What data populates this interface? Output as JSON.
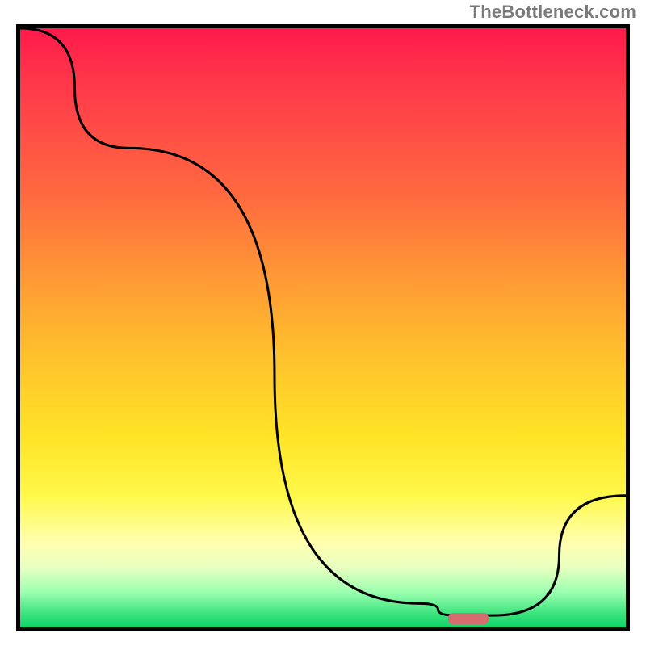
{
  "watermark": "TheBottleneck.com",
  "chart_data": {
    "type": "line",
    "title": "",
    "xlabel": "",
    "ylabel": "",
    "xlim": [
      0,
      100
    ],
    "ylim": [
      0,
      100
    ],
    "grid": false,
    "legend": false,
    "series": [
      {
        "name": "bottleneck-curve",
        "x": [
          0,
          18,
          66,
          72,
          78,
          100
        ],
        "values": [
          100,
          80,
          4,
          2,
          2,
          22
        ]
      }
    ],
    "annotations": [
      {
        "name": "optimal-marker",
        "x": 74,
        "y": 2,
        "color": "#d76b6f"
      }
    ],
    "background_gradient": {
      "direction": "vertical",
      "stops": [
        {
          "pos": 0,
          "color": "#ff1a4b"
        },
        {
          "pos": 50,
          "color": "#ffc22d"
        },
        {
          "pos": 80,
          "color": "#fff84a"
        },
        {
          "pos": 100,
          "color": "#0fd168"
        }
      ]
    }
  }
}
